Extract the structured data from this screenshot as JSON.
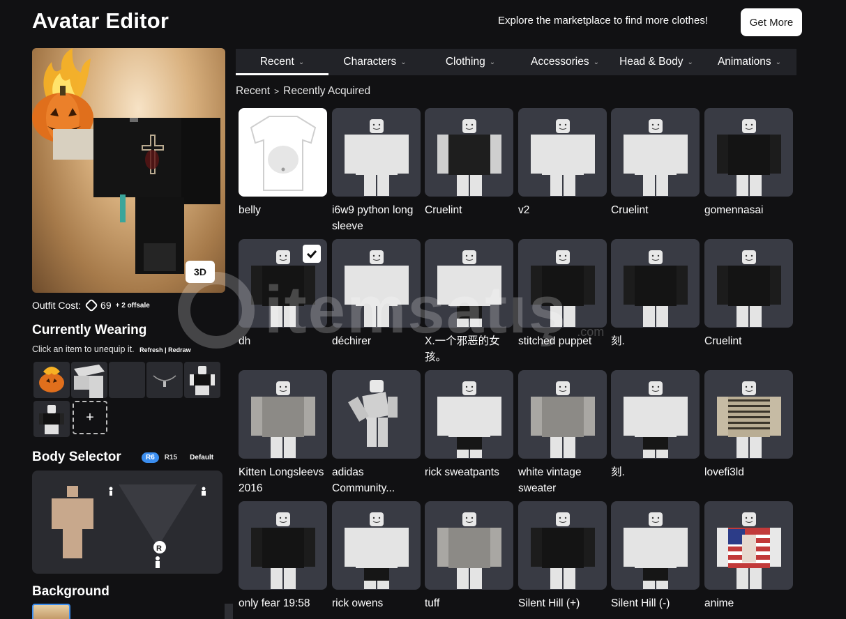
{
  "header": {
    "title": "Avatar Editor",
    "promo_text": "Explore the marketplace to find more clothes!",
    "get_more_label": "Get More"
  },
  "preview": {
    "view_toggle_label": "3D"
  },
  "outfit": {
    "cost_label": "Outfit Cost:",
    "cost_value": "69",
    "offsale_note": "+ 2 offsale"
  },
  "currently_wearing": {
    "title": "Currently Wearing",
    "hint": "Click an item to unequip it.",
    "links": "Refresh | Redraw",
    "add_label": "+"
  },
  "body_selector": {
    "title": "Body Selector",
    "options": [
      "R6",
      "R15",
      "Default"
    ],
    "selected": "R6"
  },
  "background": {
    "title": "Background"
  },
  "tabs": [
    {
      "label": "Recent",
      "active": true
    },
    {
      "label": "Characters",
      "active": false
    },
    {
      "label": "Clothing",
      "active": false
    },
    {
      "label": "Accessories",
      "active": false
    },
    {
      "label": "Head & Body",
      "active": false
    },
    {
      "label": "Animations",
      "active": false
    }
  ],
  "breadcrumb": {
    "root": "Recent",
    "separator": ">",
    "current": "Recently Acquired"
  },
  "items": [
    {
      "name": "belly",
      "style": "tshirt"
    },
    {
      "name": "i6w9 python long sleeve",
      "style": "white"
    },
    {
      "name": "Cruelint",
      "style": "whiteblack"
    },
    {
      "name": "v2",
      "style": "white"
    },
    {
      "name": "Cruelint",
      "style": "white"
    },
    {
      "name": "gomennasai",
      "style": "black"
    },
    {
      "name": "dh",
      "style": "black",
      "equipped": true
    },
    {
      "name": "déchirer",
      "style": "white"
    },
    {
      "name": "X.一个邪恶的女孩。",
      "style": "whiteblacklegs"
    },
    {
      "name": "stitched puppet",
      "style": "black"
    },
    {
      "name": "刻.",
      "style": "black"
    },
    {
      "name": "Cruelint",
      "style": "black"
    },
    {
      "name": "Kitten Longsleevs 2016",
      "style": "grey"
    },
    {
      "name": "adidas Community...",
      "style": "pose"
    },
    {
      "name": "rick sweatpants",
      "style": "whiteblacklegs"
    },
    {
      "name": "white vintage sweater",
      "style": "grey"
    },
    {
      "name": "刻.",
      "style": "whiteblacklegs"
    },
    {
      "name": "lovefi3ld",
      "style": "striped"
    },
    {
      "name": "only fear 19:58",
      "style": "black"
    },
    {
      "name": "rick owens",
      "style": "whiteblacklegs"
    },
    {
      "name": "tuff",
      "style": "grey"
    },
    {
      "name": "Silent Hill (+)",
      "style": "black"
    },
    {
      "name": "Silent Hill (-)",
      "style": "whiteblacklegs"
    },
    {
      "name": "anime",
      "style": "flag"
    }
  ],
  "watermark": {
    "text": "itemsatış",
    "suffix": ".com"
  },
  "colors": {
    "background": "#111113",
    "tab_bar": "#222328",
    "card": "#393b44",
    "accent": "#3b8ef0"
  }
}
